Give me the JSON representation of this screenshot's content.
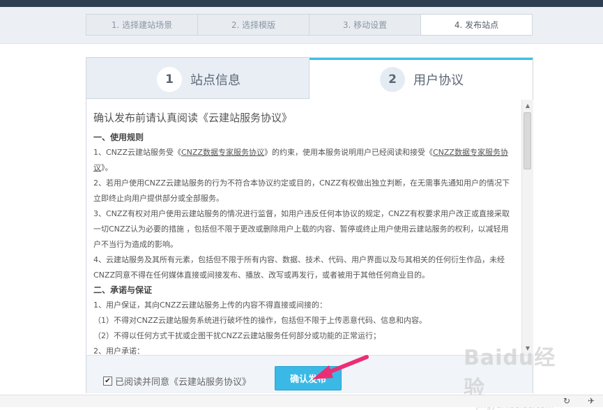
{
  "steps": [
    {
      "label": "1. 选择建站场景",
      "active": false
    },
    {
      "label": "2. 选择模版",
      "active": false
    },
    {
      "label": "3. 移动设置",
      "active": false
    },
    {
      "label": "4. 发布站点",
      "active": true
    }
  ],
  "tabs": [
    {
      "num": "1",
      "label": "站点信息"
    },
    {
      "num": "2",
      "label": "用户协议"
    }
  ],
  "agreement": {
    "title": "确认发布前请认真阅读《云建站服务协议》",
    "sec1": "一、使用规则",
    "p1a": "1、CNZZ云建站服务受《",
    "p1link1": "CNZZ数据专家服务协议",
    "p1b": "》的约束，使用本服务说明用户已经阅读和接受《",
    "p1link2": "CNZZ数据专家服务协议",
    "p1c": "》。",
    "p2": "2、若用户使用CNZZ云建站服务的行为不符合本协议约定或目的，CNZZ有权做出独立判断，在无需事先通知用户的情况下立即终止向用户提供部分或全部服务。",
    "p3": "3、CNZZ有权对用户使用云建站服务的情况进行监督，如用户违反任何本协议的规定，CNZZ有权要求用户改正或直接采取一切CNZZ认为必要的措施 ，包括但不限于更改或删除用户上载的内容、暂停或终止用户使用云建站服务的权利，以减轻用户不当行为造成的影响。",
    "p4": "4、云建站服务及其所有元素，包括但不限于所有内容、数据、技术、代码、用户界面以及与其相关的任何衍生作品，未经CNZZ同意不得在任何媒体直接或间接发布、播放、改写或再发行，或者被用于其他任何商业目的。",
    "sec2": "二、承诺与保证",
    "p5": "1、用户保证，其向CNZZ云建站服务上传的内容不得直接或间接的：",
    "p6": "（1）不得对CNZZ云建站服务系统进行破坏性的操作，包括但不限于上传恶意代码、信息和内容。",
    "p7": "（2）不得以任何方式干扰或企图干扰CNZZ云建站服务任何部分或功能的正常运行；",
    "p8": "2、用户承诺："
  },
  "footer": {
    "checkbox_checked": true,
    "agree_label": "已阅读并同意《云建站服务协议》",
    "confirm_label": "确认发布"
  },
  "watermark": {
    "logo": "Baidu经验",
    "url": "jingyan.baidu.com"
  }
}
